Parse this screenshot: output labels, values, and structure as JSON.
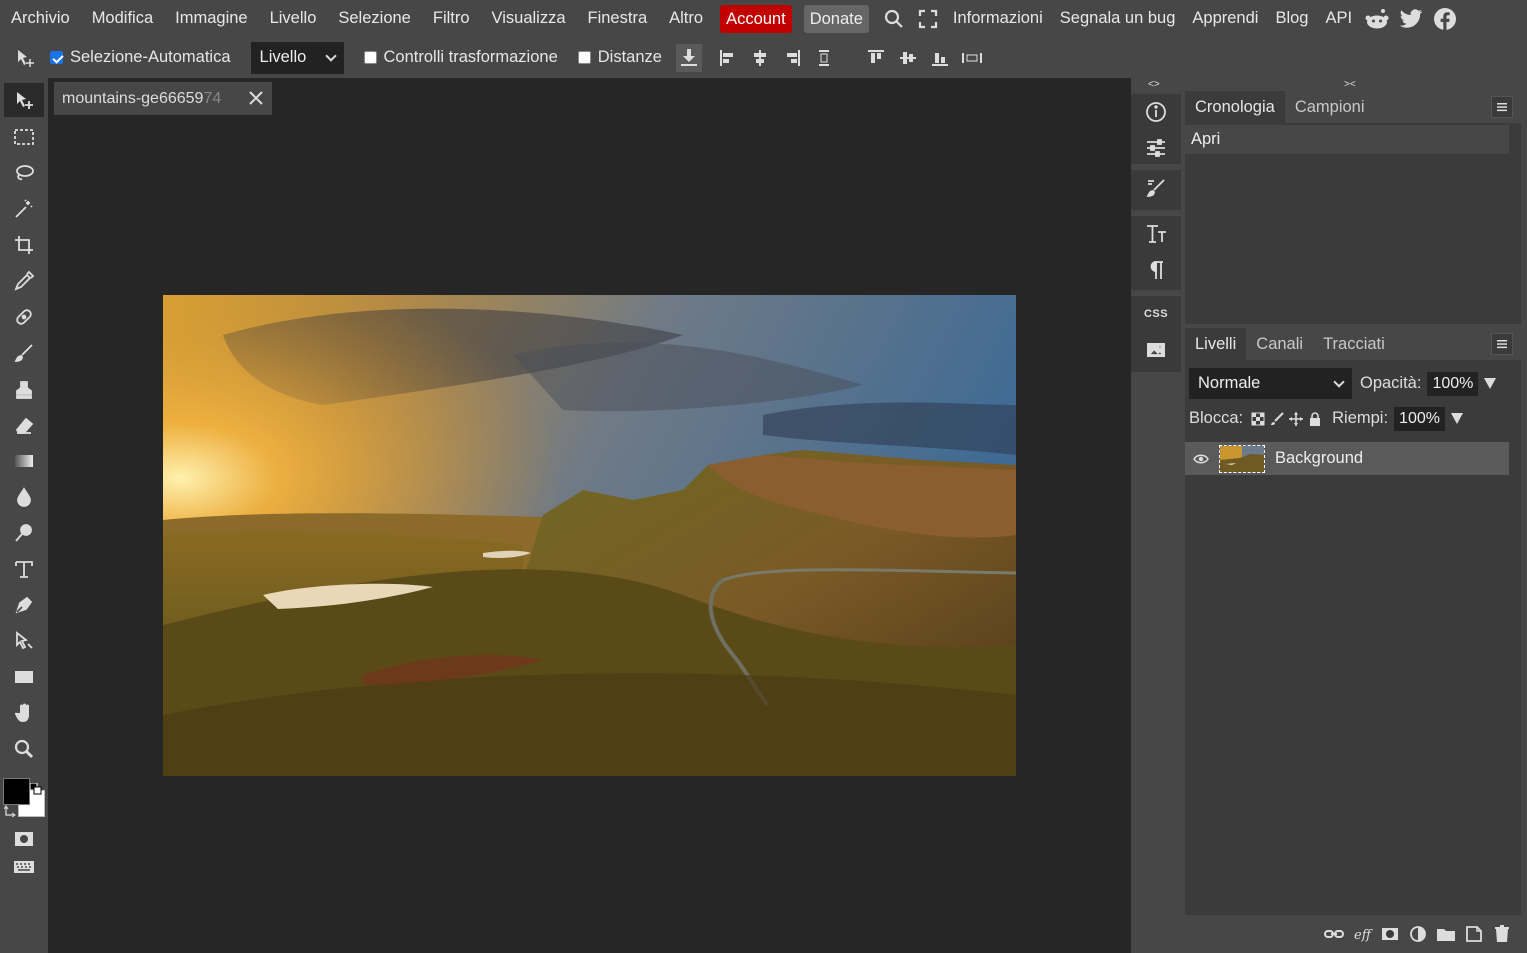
{
  "menubar": {
    "items": [
      "Archivio",
      "Modifica",
      "Immagine",
      "Livello",
      "Selezione",
      "Filtro",
      "Visualizza",
      "Finestra",
      "Altro"
    ],
    "account_label": "Account",
    "donate_label": "Donate",
    "links": [
      "Informazioni",
      "Segnala un bug",
      "Apprendi",
      "Blog",
      "API"
    ]
  },
  "options": {
    "auto_select_label": "Selezione-Automatica",
    "auto_select_checked": true,
    "target_select_value": "Livello",
    "transform_controls_label": "Controlli trasformazione",
    "distances_label": "Distanze"
  },
  "document": {
    "tab_title_visible": "mountains-ge66659",
    "tab_title_faded": "74"
  },
  "history_panel": {
    "tabs": [
      "Cronologia",
      "Campioni"
    ],
    "entries": [
      "Apri"
    ]
  },
  "layers_panel": {
    "tabs": [
      "Livelli",
      "Canali",
      "Tracciati"
    ],
    "blend_mode": "Normale",
    "opacity_label": "Opacità:",
    "opacity_value": "100%",
    "lock_label": "Blocca:",
    "fill_label": "Riempi:",
    "fill_value": "100%",
    "layers": [
      {
        "name": "Background",
        "visible": true
      }
    ]
  },
  "sidecol": {
    "css_label": "CSS"
  },
  "colors": {
    "accent_account": "#c20000",
    "foreground_color": "#000000",
    "background_color": "#ffffff"
  }
}
